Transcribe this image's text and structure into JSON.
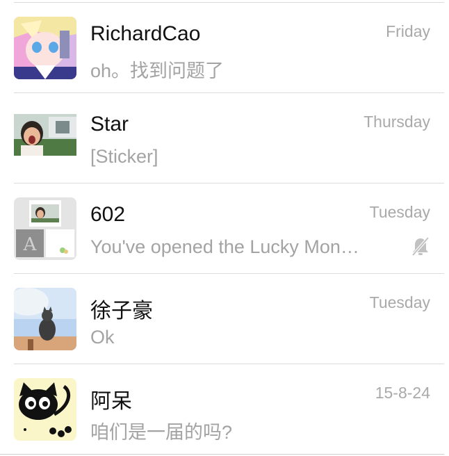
{
  "chats": [
    {
      "name": "RichardCao",
      "time": "Friday",
      "preview": "oh。找到问题了",
      "avatar": "anime-character-avatar",
      "muted": false
    },
    {
      "name": "Star",
      "time": "Thursday",
      "preview": "[Sticker]",
      "avatar": "child-photo-avatar",
      "muted": false
    },
    {
      "name": "602",
      "time": "Tuesday",
      "preview": "You've opened the Lucky Mon…",
      "avatar": "group-collage-avatar",
      "muted": true,
      "mute_icon": "bell-slash-icon"
    },
    {
      "name": "徐子豪",
      "time": "Tuesday",
      "preview": "Ok",
      "avatar": "cat-photo-avatar",
      "muted": false
    },
    {
      "name": "阿呆",
      "time": "15-8-24",
      "preview": "咱们是一届的吗?",
      "avatar": "black-cat-cartoon-avatar",
      "muted": false
    }
  ],
  "colors": {
    "name": "#111111",
    "secondary_text": "#a3a3a3",
    "separator": "#dcdcdc",
    "background": "#ffffff"
  }
}
